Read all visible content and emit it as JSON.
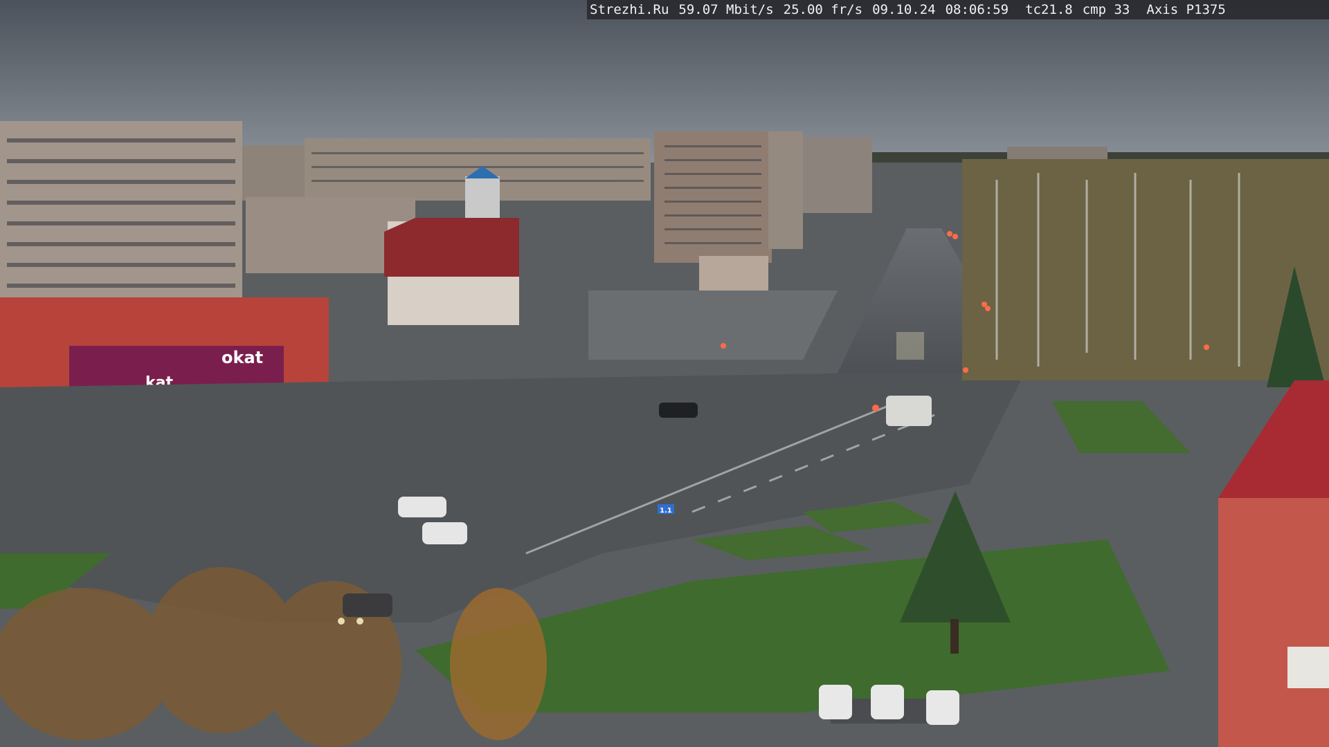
{
  "overlay": {
    "site": "Strezhi.Ru",
    "bitrate": "59.07 Mbit/s",
    "framerate": "25.00 fr/s",
    "date": "09.10.24",
    "time": "08:06:59",
    "tc": "tc21.8",
    "cmp": "cmp 33",
    "camera": "Axis P1375"
  },
  "signs": {
    "store_brand": "okat",
    "store_brand_2": "kat",
    "road_sign": "1.1"
  },
  "colors": {
    "sky": "#5b626b",
    "asphalt": "#54585c",
    "grass": "#3f6b2e",
    "store_red": "#b8433a",
    "store_sign_purple": "#7a1f4d"
  }
}
